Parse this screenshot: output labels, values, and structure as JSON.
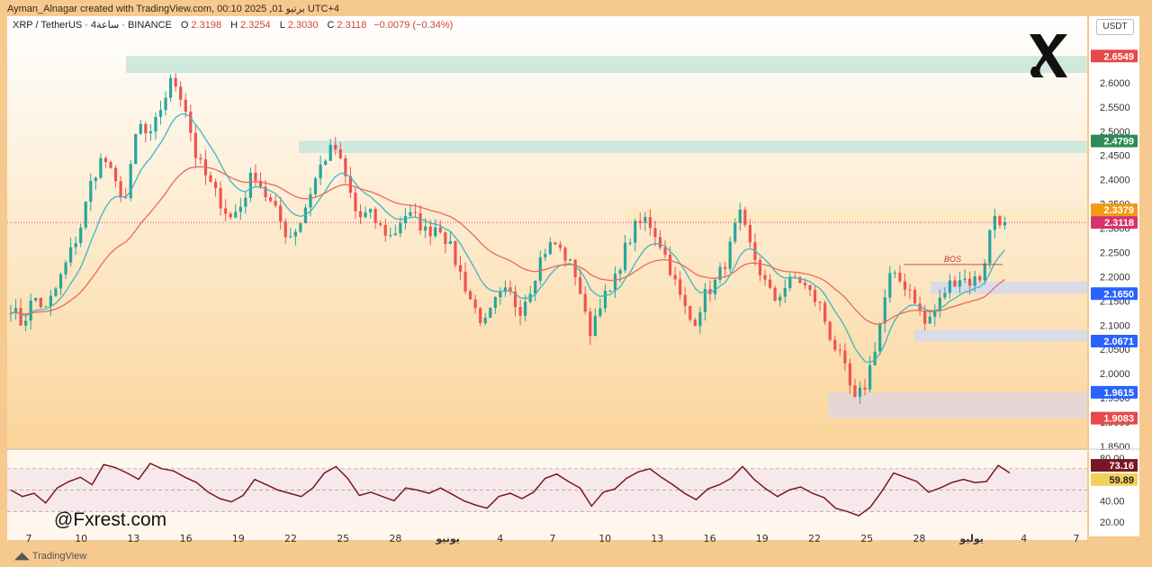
{
  "header": {
    "credit": "Ayman_Alnagar created with TradingView.com, 00:10 2025 ,01 برتيو UTC+4",
    "symbol": "XRP / TetherUS · 4ساعة · BINANCE",
    "open_label": "O",
    "open": "2.3198",
    "high_label": "H",
    "high": "2.3254",
    "low_label": "L",
    "low": "2.3030",
    "close_label": "C",
    "close": "2.3118",
    "change": "−0.0079 (−0.34%)"
  },
  "currency_button": "USDT",
  "watermark": "@Fxrest.com",
  "footer_logo": "TradingView",
  "annotations": {
    "bos": "BOS"
  },
  "colors": {
    "up": "#26a69a",
    "down": "#ef5350",
    "ema_fast": "#3bb8c4",
    "ema_slow": "#e86a5a",
    "bg_top": "#ffffff",
    "bg_bottom": "#fbd59a",
    "rsi": "#7a1523"
  },
  "chart_data": {
    "type": "candlestick",
    "y_axis": {
      "range": [
        1.85,
        2.7
      ],
      "ticks": [
        "1.8500",
        "1.9000",
        "1.9500",
        "2.0000",
        "2.0500",
        "2.1000",
        "2.1500",
        "2.2000",
        "2.2500",
        "2.3000",
        "2.3500",
        "2.4000",
        "2.4500",
        "2.5000",
        "2.5500",
        "2.6000",
        "2.6500"
      ]
    },
    "x_axis": {
      "ticks": [
        "7",
        "10",
        "13",
        "16",
        "19",
        "22",
        "25",
        "28",
        "يونيو",
        "4",
        "7",
        "10",
        "13",
        "16",
        "19",
        "22",
        "25",
        "28",
        "يوليو",
        "4",
        "7"
      ]
    },
    "close_path": [
      2.14,
      2.1,
      2.16,
      2.13,
      2.18,
      2.24,
      2.3,
      2.4,
      2.45,
      2.39,
      2.36,
      2.52,
      2.48,
      2.55,
      2.61,
      2.56,
      2.45,
      2.4,
      2.36,
      2.32,
      2.35,
      2.42,
      2.37,
      2.33,
      2.28,
      2.31,
      2.38,
      2.44,
      2.47,
      2.4,
      2.32,
      2.33,
      2.3,
      2.28,
      2.33,
      2.32,
      2.29,
      2.31,
      2.26,
      2.2,
      2.14,
      2.1,
      2.15,
      2.17,
      2.13,
      2.18,
      2.25,
      2.27,
      2.24,
      2.2,
      2.08,
      2.15,
      2.17,
      2.25,
      2.3,
      2.32,
      2.28,
      2.22,
      2.15,
      2.1,
      2.16,
      2.19,
      2.24,
      2.33,
      2.26,
      2.2,
      2.15,
      2.18,
      2.2,
      2.17,
      2.14,
      2.07,
      2.02,
      1.94,
      1.98,
      2.08,
      2.2,
      2.19,
      2.17,
      2.1,
      2.13,
      2.18,
      2.2,
      2.19,
      2.2,
      2.33,
      2.31
    ],
    "price_labels": [
      {
        "value": "2.6549",
        "color": "#e64a4a"
      },
      {
        "value": "2.4799",
        "color": "#2e8b57"
      },
      {
        "value": "2.3379",
        "color": "#f39c12"
      },
      {
        "value": "2.3118",
        "color": "#d6336c"
      },
      {
        "value": "2.1650",
        "color": "#2962ff"
      },
      {
        "value": "2.0671",
        "color": "#2962ff"
      },
      {
        "value": "1.9615",
        "color": "#2962ff"
      },
      {
        "value": "1.9083",
        "color": "#e64a4a"
      }
    ],
    "zones": [
      {
        "from_x": 0.11,
        "low": 2.62,
        "high": 2.655,
        "color": "#cfe9dc"
      },
      {
        "from_x": 0.27,
        "low": 2.455,
        "high": 2.48,
        "color": "#cfe9dc"
      },
      {
        "from_x": 0.57,
        "low": 2.31,
        "high": 2.338,
        "color": "#fde9c2"
      },
      {
        "from_x": 0.855,
        "low": 2.165,
        "high": 2.19,
        "color": "#d9dbe6"
      },
      {
        "from_x": 0.84,
        "low": 2.067,
        "high": 2.09,
        "color": "#d9dbe6"
      },
      {
        "from_x": 0.76,
        "low": 1.908,
        "high": 1.961,
        "color": "#e6d6d6"
      }
    ],
    "rsi": {
      "ticks": [
        "80.00",
        "40.00",
        "20.00"
      ],
      "labels": [
        {
          "value": "73.16",
          "color": "#7a1523"
        },
        {
          "value": "59.89",
          "color": "#f2d15a"
        }
      ],
      "range": [
        10,
        85
      ],
      "values": [
        50,
        44,
        47,
        38,
        52,
        58,
        62,
        55,
        74,
        71,
        66,
        60,
        75,
        70,
        68,
        62,
        57,
        48,
        42,
        39,
        45,
        60,
        55,
        50,
        47,
        44,
        52,
        66,
        72,
        61,
        45,
        48,
        44,
        40,
        52,
        50,
        47,
        52,
        46,
        40,
        36,
        33,
        44,
        47,
        42,
        48,
        61,
        65,
        58,
        52,
        35,
        48,
        51,
        61,
        67,
        70,
        62,
        55,
        47,
        41,
        51,
        55,
        61,
        72,
        60,
        51,
        44,
        50,
        53,
        47,
        43,
        33,
        30,
        26,
        34,
        49,
        66,
        62,
        58,
        48,
        52,
        57,
        60,
        57,
        58,
        73,
        66
      ]
    }
  }
}
